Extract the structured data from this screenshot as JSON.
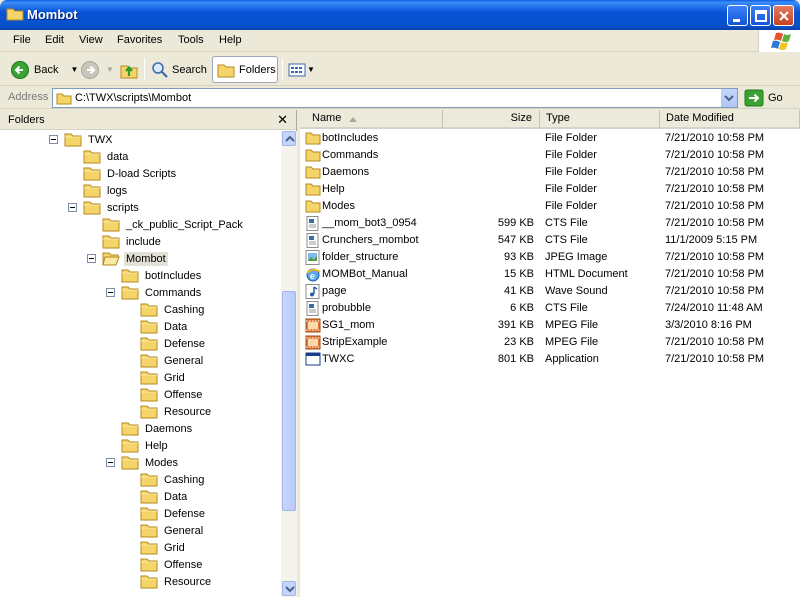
{
  "window": {
    "title": "Mombot"
  },
  "menu": [
    "File",
    "Edit",
    "View",
    "Favorites",
    "Tools",
    "Help"
  ],
  "toolbar": {
    "back": "Back",
    "search": "Search",
    "folders": "Folders"
  },
  "address": {
    "label": "Address",
    "path": "C:\\TWX\\scripts\\Mombot",
    "go": "Go"
  },
  "folders_pane": {
    "title": "Folders",
    "close": "✕",
    "tree": [
      {
        "label": "TWX",
        "indent": 0,
        "expander": true
      },
      {
        "label": "data",
        "indent": 1
      },
      {
        "label": "D-load Scripts",
        "indent": 1
      },
      {
        "label": "logs",
        "indent": 1
      },
      {
        "label": "scripts",
        "indent": 1,
        "expander": true
      },
      {
        "label": "_ck_public_Script_Pack",
        "indent": 2
      },
      {
        "label": "include",
        "indent": 2
      },
      {
        "label": "Mombot",
        "indent": 2,
        "expander": true,
        "selected": true,
        "open": true
      },
      {
        "label": "botIncludes",
        "indent": 3
      },
      {
        "label": "Commands",
        "indent": 3,
        "expander": true
      },
      {
        "label": "Cashing",
        "indent": 4
      },
      {
        "label": "Data",
        "indent": 4
      },
      {
        "label": "Defense",
        "indent": 4
      },
      {
        "label": "General",
        "indent": 4
      },
      {
        "label": "Grid",
        "indent": 4
      },
      {
        "label": "Offense",
        "indent": 4
      },
      {
        "label": "Resource",
        "indent": 4
      },
      {
        "label": "Daemons",
        "indent": 3
      },
      {
        "label": "Help",
        "indent": 3
      },
      {
        "label": "Modes",
        "indent": 3,
        "expander": true
      },
      {
        "label": "Cashing",
        "indent": 4
      },
      {
        "label": "Data",
        "indent": 4
      },
      {
        "label": "Defense",
        "indent": 4
      },
      {
        "label": "General",
        "indent": 4
      },
      {
        "label": "Grid",
        "indent": 4
      },
      {
        "label": "Offense",
        "indent": 4
      },
      {
        "label": "Resource",
        "indent": 4
      }
    ]
  },
  "columns": {
    "name": "Name",
    "size": "Size",
    "type": "Type",
    "date": "Date Modified"
  },
  "files": [
    {
      "name": "botIncludes",
      "size": "",
      "type": "File Folder",
      "date": "7/21/2010 10:58 PM",
      "icon": "folder"
    },
    {
      "name": "Commands",
      "size": "",
      "type": "File Folder",
      "date": "7/21/2010 10:58 PM",
      "icon": "folder"
    },
    {
      "name": "Daemons",
      "size": "",
      "type": "File Folder",
      "date": "7/21/2010 10:58 PM",
      "icon": "folder"
    },
    {
      "name": "Help",
      "size": "",
      "type": "File Folder",
      "date": "7/21/2010 10:58 PM",
      "icon": "folder"
    },
    {
      "name": "Modes",
      "size": "",
      "type": "File Folder",
      "date": "7/21/2010 10:58 PM",
      "icon": "folder"
    },
    {
      "name": "__mom_bot3_0954",
      "size": "599 KB",
      "type": "CTS File",
      "date": "7/21/2010 10:58 PM",
      "icon": "cts"
    },
    {
      "name": "Crunchers_mombot",
      "size": "547 KB",
      "type": "CTS File",
      "date": "11/1/2009 5:15 PM",
      "icon": "cts"
    },
    {
      "name": "folder_structure",
      "size": "93 KB",
      "type": "JPEG Image",
      "date": "7/21/2010 10:58 PM",
      "icon": "jpeg"
    },
    {
      "name": "MOMBot_Manual",
      "size": "15 KB",
      "type": "HTML Document",
      "date": "7/21/2010 10:58 PM",
      "icon": "html"
    },
    {
      "name": "page",
      "size": "41 KB",
      "type": "Wave Sound",
      "date": "7/21/2010 10:58 PM",
      "icon": "wave"
    },
    {
      "name": "probubble",
      "size": "6 KB",
      "type": "CTS File",
      "date": "7/24/2010 11:48 AM",
      "icon": "cts"
    },
    {
      "name": "SG1_mom",
      "size": "391 KB",
      "type": "MPEG File",
      "date": "3/3/2010 8:16 PM",
      "icon": "mpeg"
    },
    {
      "name": "StripExample",
      "size": "23 KB",
      "type": "MPEG File",
      "date": "7/21/2010 10:58 PM",
      "icon": "mpeg"
    },
    {
      "name": "TWXC",
      "size": "801 KB",
      "type": "Application",
      "date": "7/21/2010 10:58 PM",
      "icon": "app"
    }
  ]
}
